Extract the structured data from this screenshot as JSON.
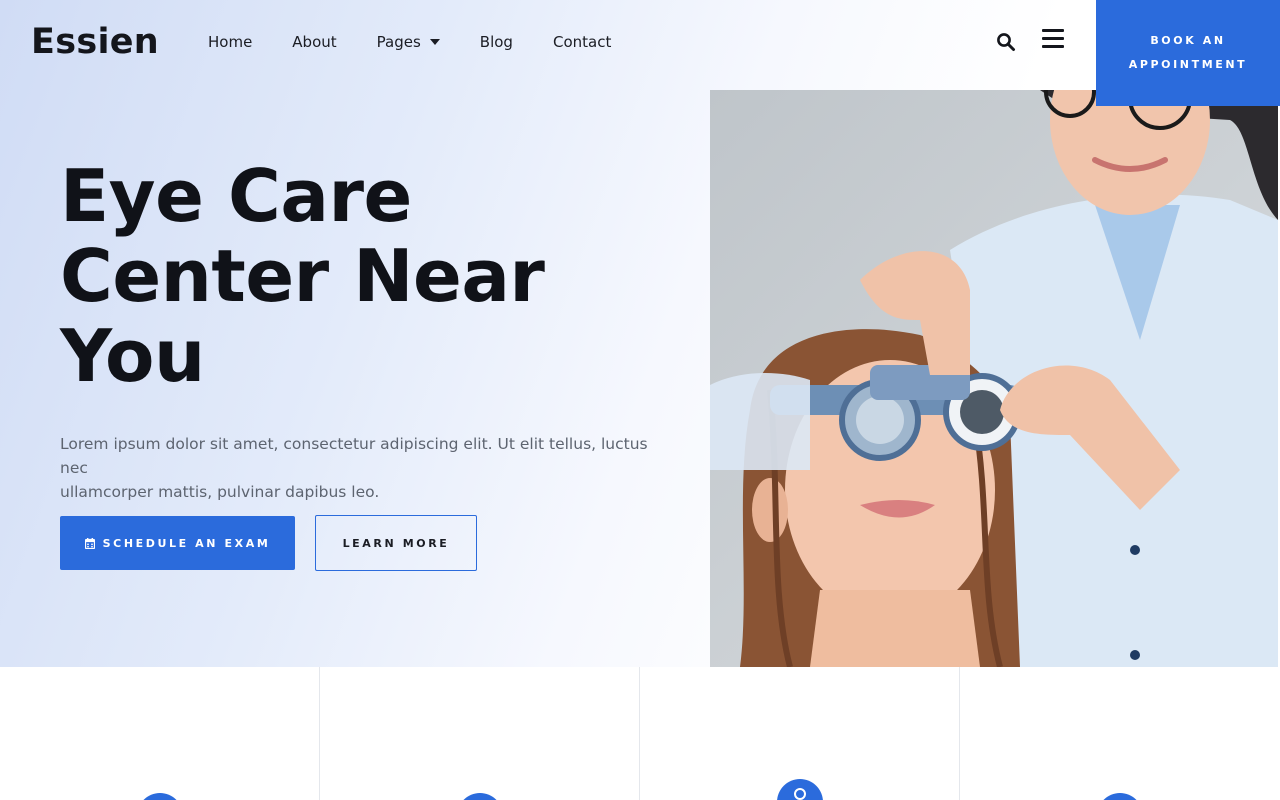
{
  "header": {
    "logo": "Essien",
    "nav": [
      "Home",
      "About",
      "Pages",
      "Blog",
      "Contact"
    ],
    "book_button": [
      "BOOK AN",
      "APPOINTMENT"
    ]
  },
  "hero": {
    "title_lines": [
      "Eye Care",
      "Center Near",
      "You"
    ],
    "description_lines": [
      "Lorem ipsum dolor sit amet, consectetur adipiscing elit. Ut elit tellus, luctus nec",
      "ullamcorper mattis, pulvinar dapibus leo."
    ],
    "primary_button": "SCHEDULE AN EXAM",
    "secondary_button": "LEARN MORE"
  },
  "colors": {
    "accent": "#2b6bdc",
    "heading": "#101218",
    "body_text": "#5d6470"
  },
  "icons": [
    "search-icon",
    "hamburger-menu-icon",
    "calendar-icon"
  ]
}
